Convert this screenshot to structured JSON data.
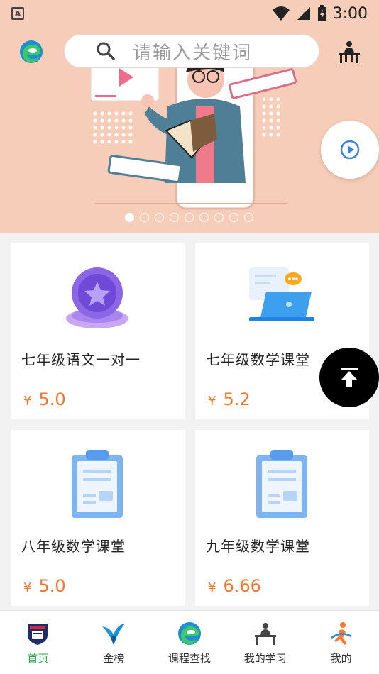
{
  "status_bar": {
    "time": "3:00",
    "app_letter": "A"
  },
  "search": {
    "placeholder": "请输入关键词"
  },
  "banner": {
    "dot_count": 9,
    "active_dot": 0
  },
  "courses": [
    {
      "title": "七年级语文一对一",
      "currency": "¥",
      "price": "5.0",
      "icon": "medal-icon"
    },
    {
      "title": "七年级数学课堂",
      "currency": "¥",
      "price": "5.2",
      "icon": "laptop-chat-icon"
    },
    {
      "title": "八年级数学课堂",
      "currency": "¥",
      "price": "5.0",
      "icon": "clipboard-icon"
    },
    {
      "title": "九年级数学课堂",
      "currency": "¥",
      "price": "6.66",
      "icon": "clipboard-icon"
    }
  ],
  "nav": [
    {
      "label": "首页",
      "icon": "shield-home-icon",
      "active": true
    },
    {
      "label": "金榜",
      "icon": "swallow-icon",
      "active": false
    },
    {
      "label": "课程查找",
      "icon": "edge-logo-icon",
      "active": false
    },
    {
      "label": "我的学习",
      "icon": "study-desk-icon",
      "active": false
    },
    {
      "label": "我的",
      "icon": "profile-figure-icon",
      "active": false
    }
  ],
  "colors": {
    "banner_bg": "#f6cdb8",
    "price": "#f5762a",
    "nav_active": "#2aa84a"
  }
}
